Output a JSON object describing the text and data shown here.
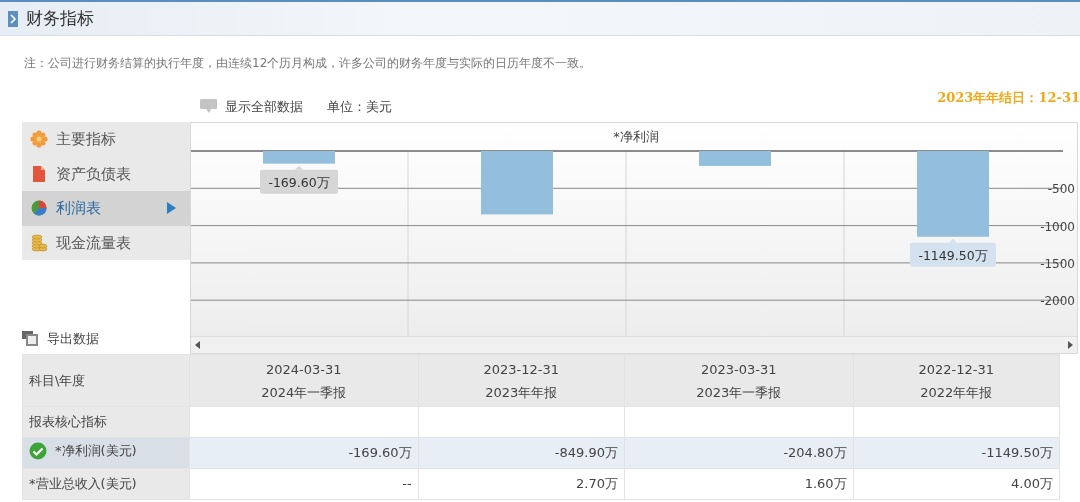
{
  "header": {
    "title": "财务指标"
  },
  "note": "注：公司进行财务结算的执行年度，由连续12个历月构成，许多公司的财务年度与实际的日历年度不一致。",
  "toolbar": {
    "show_all": "显示全部数据",
    "unit": "单位：美元",
    "fiscal_year_end": "2023年年结日：12-31"
  },
  "sidebar": {
    "items": [
      {
        "label": "主要指标",
        "selected": false
      },
      {
        "label": "资产负债表",
        "selected": false
      },
      {
        "label": "利润表",
        "selected": true
      },
      {
        "label": "现金流量表",
        "selected": false
      }
    ],
    "export": "导出数据"
  },
  "chart": {
    "chart_data": {
      "type": "bar",
      "title": "*净利润",
      "values": [
        -170,
        -850,
        -200,
        -1150
      ],
      "grid": true,
      "ylim": [
        -2480,
        0
      ],
      "yticks": [
        {
          "value": -500,
          "label": "-500"
        },
        {
          "value": -1000,
          "label": "-1000"
        },
        {
          "value": -1500,
          "label": "-1500"
        },
        {
          "value": -2000,
          "label": "-2000"
        }
      ],
      "annotations": [
        {
          "y": -170,
          "text": "-169.60万"
        },
        {
          "y": -1150,
          "text": "-1149.50万"
        }
      ]
    }
  },
  "table": {
    "corner": "科目\\年度",
    "columns": [
      {
        "date": "2024-03-31",
        "report": "2024年一季报"
      },
      {
        "date": "2023-12-31",
        "report": "2023年年报"
      },
      {
        "date": "2023-03-31",
        "report": "2023年一季报"
      },
      {
        "date": "2022-12-31",
        "report": "2022年年报"
      }
    ],
    "rows": [
      {
        "label": "报表核心指标",
        "selected": false,
        "cells": []
      },
      {
        "label": "*净利润(美元)",
        "selected": true,
        "cells": [
          "-169.60万",
          "-849.90万",
          "-204.80万",
          "-1149.50万"
        ]
      },
      {
        "label": "*营业总收入(美元)",
        "selected": false,
        "cells": [
          "--",
          "2.70万",
          "1.60万",
          "4.00万"
        ]
      }
    ]
  }
}
